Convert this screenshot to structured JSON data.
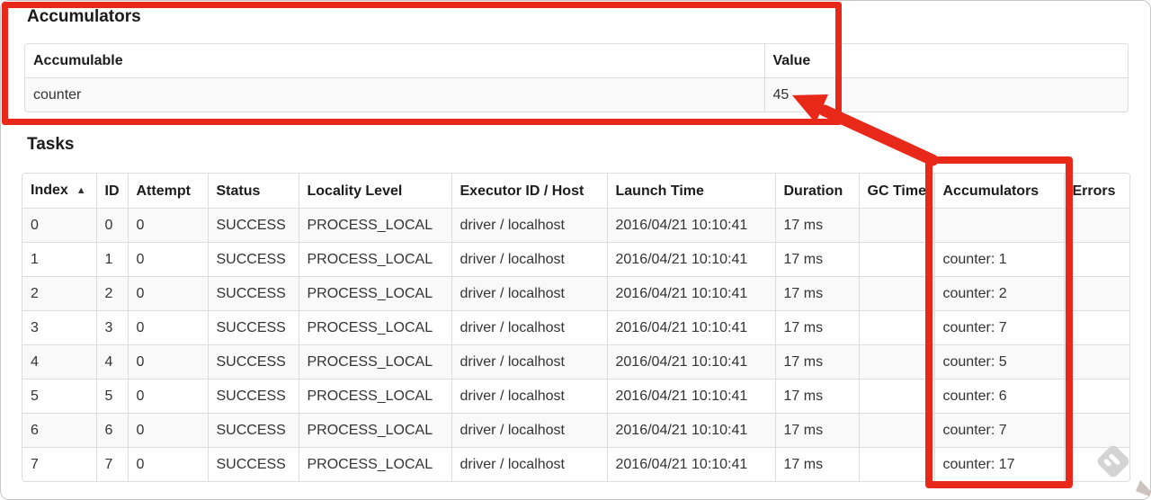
{
  "accumulators_section": {
    "title": "Accumulators",
    "table": {
      "headers": [
        "Accumulable",
        "Value"
      ],
      "rows": [
        [
          "counter",
          "45"
        ]
      ]
    }
  },
  "tasks_section": {
    "title": "Tasks",
    "table": {
      "headers": [
        "Index",
        "ID",
        "Attempt",
        "Status",
        "Locality Level",
        "Executor ID / Host",
        "Launch Time",
        "Duration",
        "GC Time",
        "Accumulators",
        "Errors"
      ],
      "sort": {
        "column": "Index",
        "indicator": "▲"
      },
      "rows": [
        [
          "0",
          "0",
          "0",
          "SUCCESS",
          "PROCESS_LOCAL",
          "driver / localhost",
          "2016/04/21 10:10:41",
          "17 ms",
          "",
          "",
          ""
        ],
        [
          "1",
          "1",
          "0",
          "SUCCESS",
          "PROCESS_LOCAL",
          "driver / localhost",
          "2016/04/21 10:10:41",
          "17 ms",
          "",
          "counter: 1",
          ""
        ],
        [
          "2",
          "2",
          "0",
          "SUCCESS",
          "PROCESS_LOCAL",
          "driver / localhost",
          "2016/04/21 10:10:41",
          "17 ms",
          "",
          "counter: 2",
          ""
        ],
        [
          "3",
          "3",
          "0",
          "SUCCESS",
          "PROCESS_LOCAL",
          "driver / localhost",
          "2016/04/21 10:10:41",
          "17 ms",
          "",
          "counter: 7",
          ""
        ],
        [
          "4",
          "4",
          "0",
          "SUCCESS",
          "PROCESS_LOCAL",
          "driver / localhost",
          "2016/04/21 10:10:41",
          "17 ms",
          "",
          "counter: 5",
          ""
        ],
        [
          "5",
          "5",
          "0",
          "SUCCESS",
          "PROCESS_LOCAL",
          "driver / localhost",
          "2016/04/21 10:10:41",
          "17 ms",
          "",
          "counter: 6",
          ""
        ],
        [
          "6",
          "6",
          "0",
          "SUCCESS",
          "PROCESS_LOCAL",
          "driver / localhost",
          "2016/04/21 10:10:41",
          "17 ms",
          "",
          "counter: 7",
          ""
        ],
        [
          "7",
          "7",
          "0",
          "SUCCESS",
          "PROCESS_LOCAL",
          "driver / localhost",
          "2016/04/21 10:10:41",
          "17 ms",
          "",
          "counter: 17",
          ""
        ]
      ]
    }
  },
  "annotations": {
    "highlight_color": "#e8291a",
    "arrow_points_at": "45"
  },
  "colors": {
    "stripe": "#f9f9f9",
    "table_border": "#dddddd",
    "watermark_gray": "#d3d3d3"
  },
  "icons": {
    "sort_ascending": "▲",
    "watermark": "pencil-badge"
  }
}
